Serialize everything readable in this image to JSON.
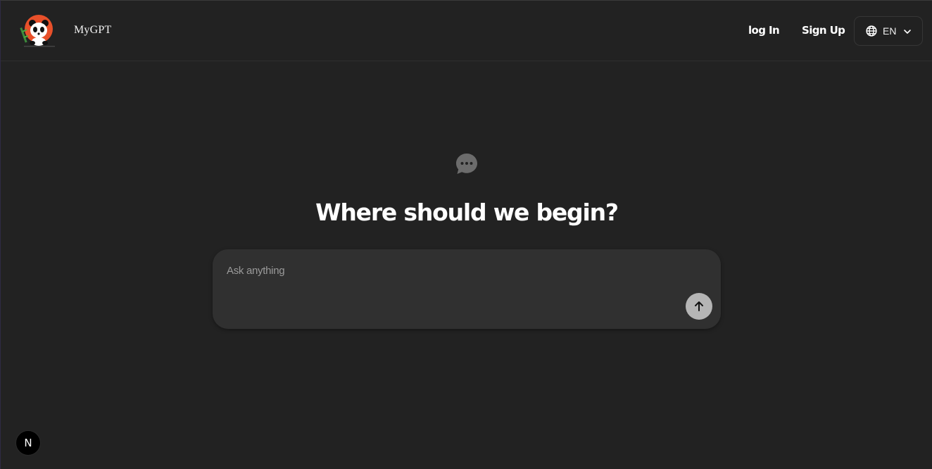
{
  "header": {
    "brand_name": "MyGPT",
    "login_label": "log In",
    "signup_label": "Sign Up",
    "language": {
      "current": "EN",
      "icon": "globe-icon",
      "chevron_icon": "chevron-down-icon"
    },
    "logo_icon": "panda-logo"
  },
  "main": {
    "icon": "chat-bubble-dots-icon",
    "headline": "Where should we begin?",
    "composer": {
      "placeholder": "Ask anything",
      "value": "",
      "send_icon": "arrow-up-icon"
    }
  },
  "footer": {
    "dev_badge_label": "N"
  },
  "colors": {
    "background": "#222222",
    "composer_bg": "#303030",
    "send_button_bg": "#b5b5b5",
    "logo_accent": "#e8502a"
  }
}
